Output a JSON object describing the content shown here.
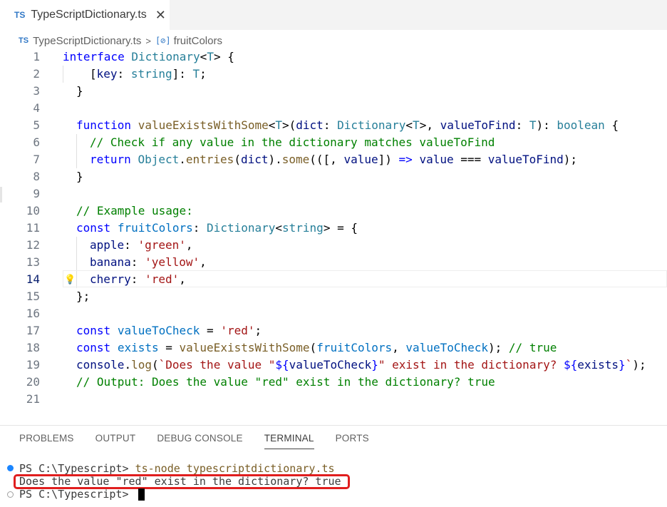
{
  "tab": {
    "badge": "TS",
    "title": "TypeScriptDictionary.ts",
    "close": "✕"
  },
  "breadcrumb": {
    "badge": "TS",
    "file": "TypeScriptDictionary.ts",
    "separator": ">",
    "symbol_icon": "symbol-variable-icon",
    "symbol": "fruitColors"
  },
  "editor": {
    "active_line": 14,
    "lines": [
      {
        "n": "1"
      },
      {
        "n": "2"
      },
      {
        "n": "3"
      },
      {
        "n": "4"
      },
      {
        "n": "5"
      },
      {
        "n": "6"
      },
      {
        "n": "7"
      },
      {
        "n": "8"
      },
      {
        "n": "9"
      },
      {
        "n": "10"
      },
      {
        "n": "11"
      },
      {
        "n": "12"
      },
      {
        "n": "13"
      },
      {
        "n": "14"
      },
      {
        "n": "15"
      },
      {
        "n": "16"
      },
      {
        "n": "17"
      },
      {
        "n": "18"
      },
      {
        "n": "19"
      },
      {
        "n": "20"
      },
      {
        "n": "21"
      }
    ],
    "code": {
      "l1": [
        "interface",
        " ",
        "Dictionary",
        "<",
        "T",
        "> {"
      ],
      "l2": [
        "[",
        "key",
        ": ",
        "string",
        "]: ",
        "T",
        ";"
      ],
      "l3": [
        "}"
      ],
      "l5": [
        "function",
        " ",
        "valueExistsWithSome",
        "<",
        "T",
        ">(",
        "dict",
        ": ",
        "Dictionary",
        "<",
        "T",
        ">, ",
        "valueToFind",
        ": ",
        "T",
        "): ",
        "boolean",
        " {"
      ],
      "l6": [
        "// Check if any value in the dictionary matches valueToFind"
      ],
      "l7": [
        "return",
        " ",
        "Object",
        ".",
        "entries",
        "(",
        "dict",
        ").",
        "some",
        "(([, ",
        "value",
        "]) ",
        "=>",
        " ",
        "value",
        " === ",
        "valueToFind",
        ");"
      ],
      "l8": [
        "}"
      ],
      "l10": [
        "// Example usage:"
      ],
      "l11": [
        "const",
        " ",
        "fruitColors",
        ": ",
        "Dictionary",
        "<",
        "string",
        "> = {"
      ],
      "l12": [
        "apple",
        ": ",
        "'green'",
        ","
      ],
      "l13": [
        "banana",
        ": ",
        "'yellow'",
        ","
      ],
      "l14": [
        "cherry",
        ": ",
        "'red'",
        ","
      ],
      "l15": [
        "};"
      ],
      "l17": [
        "const",
        " ",
        "valueToCheck",
        " = ",
        "'red'",
        ";"
      ],
      "l18": [
        "const",
        " ",
        "exists",
        " = ",
        "valueExistsWithSome",
        "(",
        "fruitColors",
        ", ",
        "valueToCheck",
        "); ",
        "// true"
      ],
      "l19": [
        "console",
        ".",
        "log",
        "(",
        "`Does the value \"",
        "${",
        "valueToCheck",
        "}",
        "\" exist in the dictionary? ",
        "${",
        "exists",
        "}",
        "`",
        ");"
      ],
      "l20": [
        "// Output: Does the value \"red\" exist in the dictionary? true"
      ]
    }
  },
  "panel": {
    "tabs": [
      "PROBLEMS",
      "OUTPUT",
      "DEBUG CONSOLE",
      "TERMINAL",
      "PORTS"
    ],
    "active_tab": "TERMINAL"
  },
  "terminal": {
    "prompt1": "PS C:\\Typescript> ",
    "command": "ts-node typescriptdictionary.ts",
    "output": "Does the value \"red\" exist in the dictionary? true",
    "prompt2": "PS C:\\Typescript> "
  },
  "colors": {
    "keyword": "#0000ff",
    "type": "#267f99",
    "variable": "#001080",
    "function": "#795e26",
    "string": "#a31515",
    "comment": "#008000",
    "highlight_box": "#e01e1e",
    "ts_badge": "#3178c6"
  }
}
